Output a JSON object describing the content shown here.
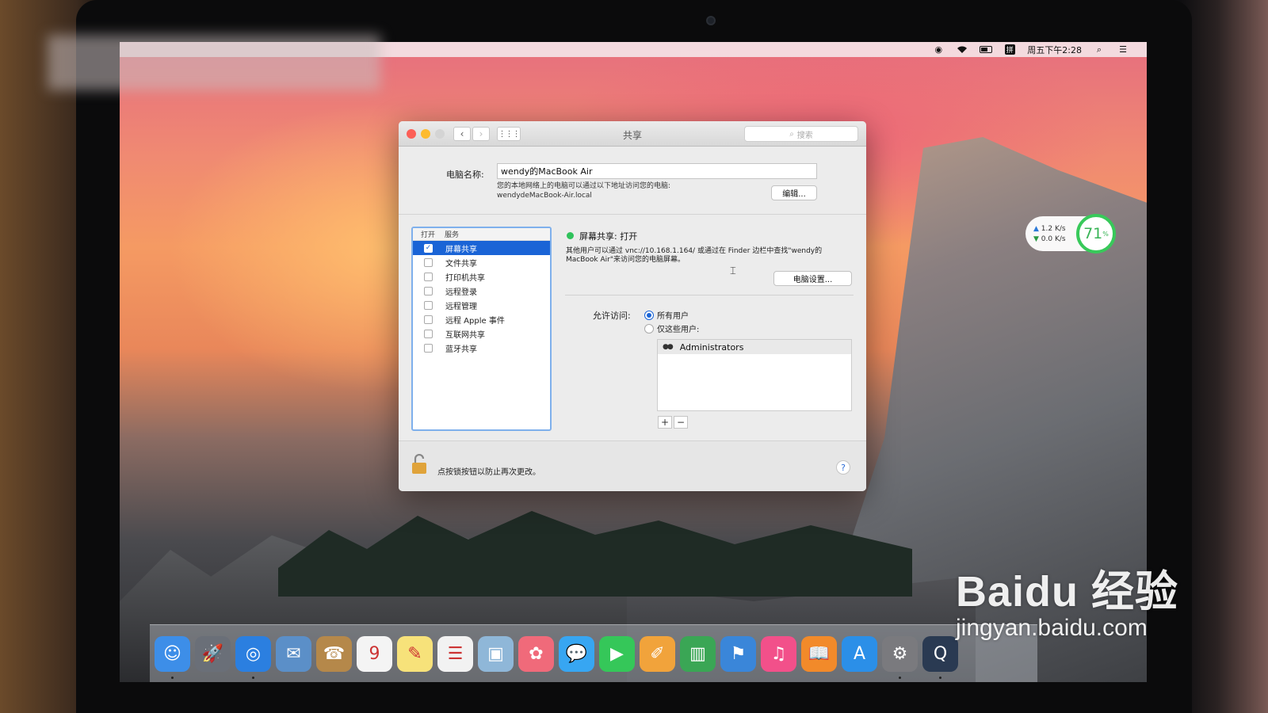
{
  "menubar": {
    "clock": "周五下午2:28",
    "ime": "拼"
  },
  "netmon": {
    "upload": "1.2 K/s",
    "download": "0.0 K/s",
    "percent": "71",
    "percent_unit": "%"
  },
  "window": {
    "title": "共享",
    "search_placeholder": "搜索",
    "computer_name_label": "电脑名称:",
    "computer_name_value": "wendy的MacBook Air",
    "address_note_line1": "您的本地网络上的电脑可以通过以下地址访问您的电脑:",
    "address_note_line2": "wendydeMacBook-Air.local",
    "edit_button": "编辑...",
    "services_header_on": "打开",
    "services_header_service": "服务",
    "services": [
      {
        "label": "屏幕共享",
        "checked": true,
        "selected": true
      },
      {
        "label": "文件共享",
        "checked": false,
        "selected": false
      },
      {
        "label": "打印机共享",
        "checked": false,
        "selected": false
      },
      {
        "label": "远程登录",
        "checked": false,
        "selected": false
      },
      {
        "label": "远程管理",
        "checked": false,
        "selected": false
      },
      {
        "label": "远程 Apple 事件",
        "checked": false,
        "selected": false
      },
      {
        "label": "互联网共享",
        "checked": false,
        "selected": false
      },
      {
        "label": "蓝牙共享",
        "checked": false,
        "selected": false
      }
    ],
    "status": "屏幕共享: 打开",
    "description_line1": "其他用户可以通过 vnc://10.168.1.164/ 或通过在 Finder 边栏中查找\"wendy的",
    "description_line2": "MacBook Air\"来访问您的电脑屏幕。",
    "computer_settings_button": "电脑设置...",
    "allow_access_label": "允许访问:",
    "radio_all_users": "所有用户",
    "radio_only_these": "仅这些用户:",
    "allow_access_selected": "所有用户",
    "users": [
      "Administrators"
    ],
    "plus": "+",
    "minus": "−",
    "lock_text": "点按锁按钮以防止再次更改。",
    "help": "?"
  },
  "dock": {
    "apps": [
      {
        "name": "finder-icon",
        "glyph": "☺",
        "color": "#3d8ee8",
        "running": true
      },
      {
        "name": "launchpad-icon",
        "glyph": "🚀",
        "color": "#6a6f78",
        "running": false
      },
      {
        "name": "safari-icon",
        "glyph": "◎",
        "color": "#2b7fe0",
        "running": true
      },
      {
        "name": "mail-icon",
        "glyph": "✉",
        "color": "#5b8fc8",
        "running": false
      },
      {
        "name": "contacts-icon",
        "glyph": "☎",
        "color": "#b5884a",
        "running": false
      },
      {
        "name": "calendar-icon",
        "glyph": "9",
        "color": "#f4f4f4",
        "running": false
      },
      {
        "name": "notes-icon",
        "glyph": "✎",
        "color": "#f7e27a",
        "running": false
      },
      {
        "name": "reminders-icon",
        "glyph": "☰",
        "color": "#f2f2f2",
        "running": false
      },
      {
        "name": "preview-icon",
        "glyph": "▣",
        "color": "#8fb7d8",
        "running": false
      },
      {
        "name": "photos-icon",
        "glyph": "✿",
        "color": "#f06a7a",
        "running": false
      },
      {
        "name": "messages-icon",
        "glyph": "💬",
        "color": "#37a6f2",
        "running": false
      },
      {
        "name": "facetime-icon",
        "glyph": "▶",
        "color": "#35c759",
        "running": false
      },
      {
        "name": "pages-icon",
        "glyph": "✐",
        "color": "#f1a33b",
        "running": false
      },
      {
        "name": "numbers-icon",
        "glyph": "▥",
        "color": "#3aa655",
        "running": false
      },
      {
        "name": "keynote-icon",
        "glyph": "⚑",
        "color": "#3a86d9",
        "running": false
      },
      {
        "name": "itunes-icon",
        "glyph": "♫",
        "color": "#f2508a",
        "running": false
      },
      {
        "name": "ibooks-icon",
        "glyph": "📖",
        "color": "#f28a2a",
        "running": false
      },
      {
        "name": "app-store-icon",
        "glyph": "A",
        "color": "#2b8fe8",
        "running": false
      },
      {
        "name": "system-preferences-icon",
        "glyph": "⚙",
        "color": "#7a7a7e",
        "running": true
      },
      {
        "name": "quicktime-icon",
        "glyph": "Q",
        "color": "#2a3a52",
        "running": true
      }
    ]
  },
  "watermark": {
    "logo": "Baidu 经验",
    "url": "jingyan.baidu.com"
  }
}
